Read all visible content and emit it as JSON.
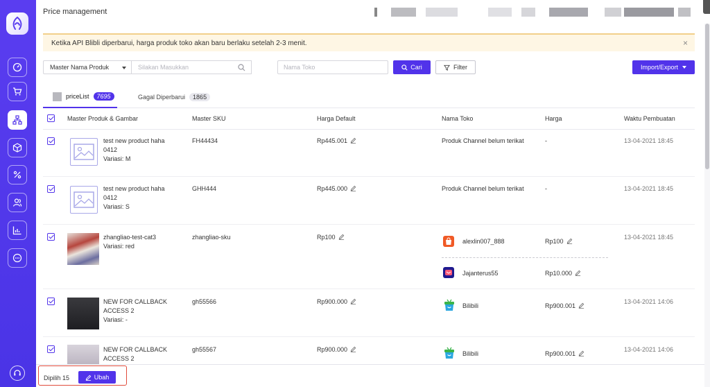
{
  "header": {
    "title": "Price management"
  },
  "notice": {
    "text": "Ketika API Blibli diperbarui, harga produk toko akan baru berlaku setelah 2-3 menit.",
    "close": "×"
  },
  "search": {
    "select_value": "Master Nama Produk",
    "keyword_placeholder": "Silakan Masukkan",
    "store_placeholder": "Nama Toko",
    "search_label": "Cari",
    "filter_label": "Filter",
    "export_label": "Import/Export"
  },
  "tabs": [
    {
      "label": "priceList",
      "count": "7695"
    },
    {
      "label": "Gagal Diperbarui",
      "count": "1865"
    }
  ],
  "table": {
    "headers": [
      "Master Produk & Gambar",
      "Master SKU",
      "Harga Default",
      "Nama Toko",
      "Harga",
      "Waktu Pembuatan"
    ],
    "rows": [
      {
        "name1": "test new product haha",
        "name2": "0412",
        "variant": "Variasi: M",
        "sku": "FH44434",
        "default_price": "Rp445.001",
        "store": "Produk Channel belum terikat",
        "price": "-",
        "created": "13-04-2021 18:45"
      },
      {
        "name1": "test new product haha",
        "name2": "0412",
        "variant": "Variasi: S",
        "sku": "GHH444",
        "default_price": "Rp445.000",
        "store": "Produk Channel belum terikat",
        "price": "-",
        "created": "13-04-2021 18:45"
      },
      {
        "name1": "zhangliao-test-cat3",
        "variant": "Variasi: red",
        "sku": "zhangliao-sku",
        "default_price": "Rp100",
        "stores": [
          {
            "name": "alexlin007_888",
            "price": "Rp100",
            "icon": "shopee-icon"
          },
          {
            "name": "Jajanterus55",
            "price": "Rp10.000",
            "icon": "lazada-icon"
          }
        ],
        "created": "13-04-2021 18:45"
      },
      {
        "name1": "NEW FOR CALLBACK",
        "name2": "ACCESS 2",
        "variant": "Variasi: -",
        "sku": "gh55566",
        "default_price": "Rp900.000",
        "store": "Bilibili",
        "price": "Rp900.001",
        "created": "13-04-2021 14:06"
      },
      {
        "name1": "NEW FOR CALLBACK",
        "name2": "ACCESS 2",
        "sku": "gh55567",
        "default_price": "Rp900.000",
        "store": "Bilibili",
        "price": "Rp900.001",
        "created": "13-04-2021 14:06"
      }
    ]
  },
  "footer": {
    "selected": "Dipilih 15",
    "edit_label": "Ubah"
  },
  "colors": {
    "primary": "#5133ea",
    "sidebar": "#4a34e6",
    "notice_bg": "#fef6e4",
    "highlight": "#e04a3a"
  }
}
